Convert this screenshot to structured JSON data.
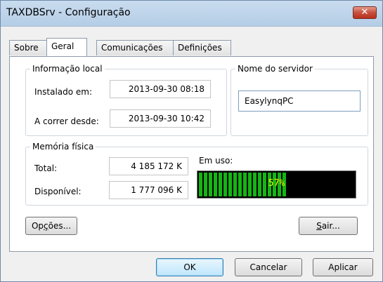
{
  "window": {
    "title": "TAXDBSrv - Configuração",
    "close_label": "✕"
  },
  "tabs": [
    {
      "label": "Sobre",
      "active": false
    },
    {
      "label": "Geral",
      "active": true
    },
    {
      "label": "Comunicações",
      "active": false
    },
    {
      "label": "Definições",
      "active": false
    }
  ],
  "local_info": {
    "legend": "Informação local",
    "installed_label": "Instalado em:",
    "installed_value": "2013-09-30  08:18",
    "running_label": "A correr desde:",
    "running_value": "2013-09-30  10:42"
  },
  "server": {
    "legend": "Nome do servidor",
    "value": "EasylynqPC"
  },
  "memory": {
    "legend": "Memória física",
    "total_label": "Total:",
    "total_value": "4 185 172  K",
    "available_label": "Disponível:",
    "available_value": "1 777 096  K",
    "in_use_label": "Em uso:",
    "in_use_text": "57%",
    "in_use_fraction": 0.57,
    "bar_color": "#14b514",
    "text_color": "#f2f200"
  },
  "buttons": {
    "options_pre": "Op",
    "options_key": "ç",
    "options_post": "ões...",
    "exit_key": "S",
    "exit_post": "air...",
    "ok": "OK",
    "cancel": "Cancelar",
    "apply": "Aplicar"
  }
}
